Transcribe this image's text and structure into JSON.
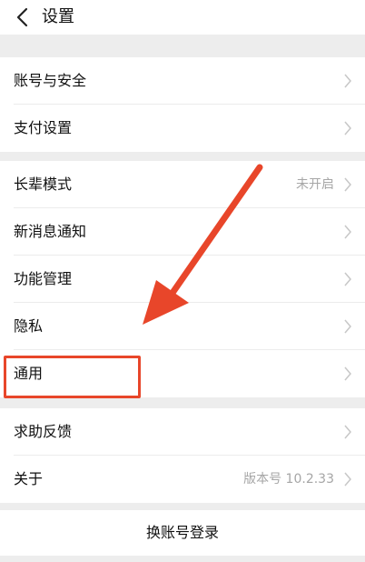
{
  "header": {
    "title": "设置"
  },
  "groups": [
    {
      "items": [
        {
          "label": "账号与安全",
          "value": ""
        },
        {
          "label": "支付设置",
          "value": ""
        }
      ]
    },
    {
      "items": [
        {
          "label": "长辈模式",
          "value": "未开启"
        },
        {
          "label": "新消息通知",
          "value": ""
        },
        {
          "label": "功能管理",
          "value": ""
        },
        {
          "label": "隐私",
          "value": ""
        },
        {
          "label": "通用",
          "value": ""
        }
      ]
    },
    {
      "items": [
        {
          "label": "求助反馈",
          "value": ""
        },
        {
          "label": "关于",
          "value": "版本号 10.2.33"
        }
      ]
    }
  ],
  "footer": {
    "switch_account_label": "换账号登录"
  },
  "colors": {
    "annotation": "#e8462a",
    "background": "#ededed",
    "secondary_text": "#a6a6a6"
  }
}
